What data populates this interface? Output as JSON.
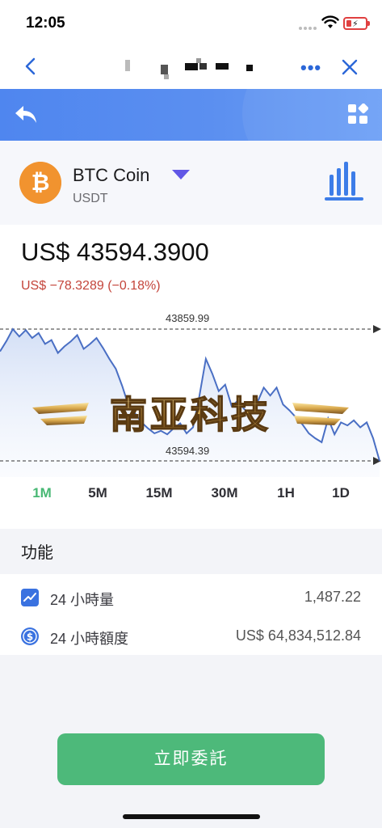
{
  "status": {
    "time": "12:05"
  },
  "nav": {
    "more_label": "•••"
  },
  "coin": {
    "name": "BTC Coin",
    "quote": "USDT",
    "logo_letter": "₿"
  },
  "price": {
    "current": "US$ 43594.3900",
    "change": "US$ −78.3289 (−0.18%)"
  },
  "chart_data": {
    "type": "line",
    "high": 43859.99,
    "low": 43594.39,
    "high_label": "43859.99",
    "low_label": "43594.39",
    "ylim": [
      43594.39,
      43859.99
    ],
    "values": [
      43815,
      43836,
      43860,
      43845,
      43858,
      43842,
      43852,
      43830,
      43838,
      43812,
      43825,
      43835,
      43848,
      43820,
      43830,
      43842,
      43822,
      43800,
      43780,
      43745,
      43705,
      43690,
      43672,
      43660,
      43650,
      43655,
      43648,
      43660,
      43670,
      43650,
      43662,
      43725,
      43800,
      43770,
      43735,
      43748,
      43705,
      43716,
      43698,
      43690,
      43712,
      43742,
      43726,
      43742,
      43708,
      43696,
      43682,
      43668,
      43650,
      43640,
      43632,
      43680,
      43648,
      43672,
      43666,
      43676,
      43662,
      43672,
      43640,
      43594.39
    ],
    "watermark": "南亚科技"
  },
  "ranges": [
    "1M",
    "5M",
    "15M",
    "30M",
    "1H",
    "1D"
  ],
  "active_range": "1M",
  "features": {
    "title": "功能",
    "rows": [
      {
        "icon": "trend-chart-icon",
        "label": "24 小時量",
        "value": "1,487.22"
      },
      {
        "icon": "dollar-coin-icon",
        "label": "24 小時額度",
        "value": "US$ 64,834,512.84"
      }
    ]
  },
  "cta": {
    "label": "立即委託"
  },
  "colors": {
    "accent_green": "#4db97a",
    "header_blue": "#5b8ff0",
    "negative_red": "#c4453b",
    "coin_orange": "#f1932f",
    "dropdown_purple": "#6157e6"
  }
}
